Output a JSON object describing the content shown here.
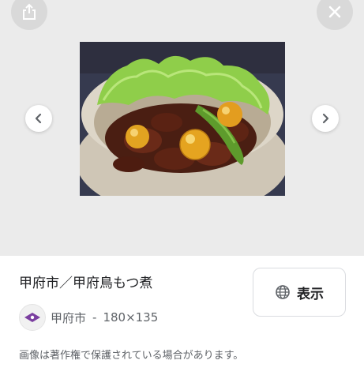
{
  "viewer": {
    "share_icon": "share-icon",
    "close_icon": "close-icon",
    "prev_icon": "chevron-left-icon",
    "next_icon": "chevron-right-icon",
    "background_color": "#ebebeb"
  },
  "result": {
    "title": "甲府市／甲府鳥もつ煮",
    "visit_label": "表示",
    "visit_icon": "globe-icon",
    "source_name": "甲府市",
    "separator": "-",
    "image_size": "180×135",
    "favicon_color": "#7b3fa0",
    "copyright_notice": "画像は著作権で保護されている場合があります。"
  }
}
